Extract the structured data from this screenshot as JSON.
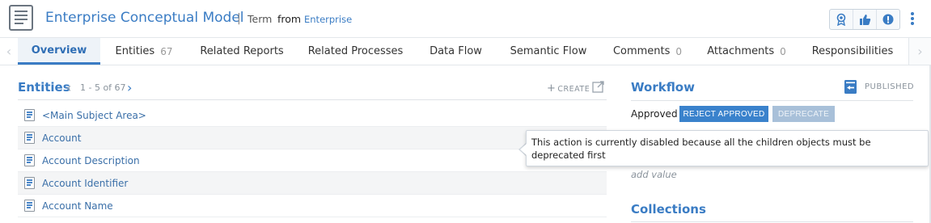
{
  "header": {
    "title": "Enterprise Conceptual Model",
    "separator": "|",
    "type_label": "Term",
    "from_label": "from",
    "domain": "Enterprise",
    "icon": "document-icon",
    "actions": [
      "endorse-icon",
      "thumbs-up-icon",
      "alert-icon"
    ],
    "more_icon": "kebab-menu-icon"
  },
  "tabs": [
    {
      "label": "Overview",
      "active": true
    },
    {
      "label": "Entities",
      "count": "67"
    },
    {
      "label": "Related Reports"
    },
    {
      "label": "Related Processes"
    },
    {
      "label": "Data Flow"
    },
    {
      "label": "Semantic Flow"
    },
    {
      "label": "Comments",
      "count": "0"
    },
    {
      "label": "Attachments",
      "count": "0"
    },
    {
      "label": "Responsibilities"
    }
  ],
  "entities": {
    "title": "Entities",
    "pager": "1 - 5 of 67",
    "create_label": "CREATE",
    "items": [
      "<Main Subject Area>",
      "Account",
      "Account Description",
      "Account Identifier",
      "Account Name"
    ]
  },
  "workflow": {
    "title": "Workflow",
    "published_label": "PUBLISHED",
    "status": "Approved",
    "reject_label": "REJECT APPROVED",
    "deprecate_label": "DEPRECATE",
    "tooltip": "This action is currently disabled because all the children objects must be deprecated first",
    "add_value": "add value"
  },
  "collections": {
    "title": "Collections"
  },
  "colors": {
    "accent": "#3a7cc4",
    "primary_button": "#3a82cc",
    "disabled_button": "#a8c0d9"
  }
}
